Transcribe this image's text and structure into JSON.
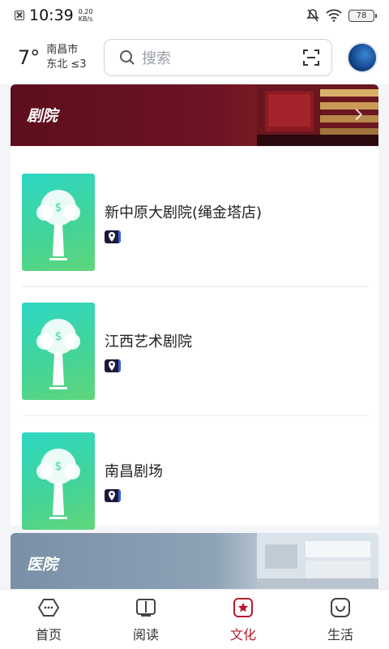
{
  "status_bar": {
    "time": "10:39",
    "speed_value": "0.20",
    "speed_unit": "KB/s",
    "battery": "78"
  },
  "header": {
    "temperature": "7°",
    "city": "南昌市",
    "wind": "东北  ≤3",
    "search_placeholder": "搜索"
  },
  "sections": [
    {
      "title": "剧院",
      "items": [
        {
          "name": "新中原大剧院(绳金塔店)"
        },
        {
          "name": "江西艺术剧院"
        },
        {
          "name": "南昌剧场"
        }
      ]
    },
    {
      "title": "医院"
    }
  ],
  "bottom_nav": [
    {
      "label": "首页",
      "icon": "home-icon"
    },
    {
      "label": "阅读",
      "icon": "book-icon"
    },
    {
      "label": "文化",
      "icon": "star-icon",
      "active": true
    },
    {
      "label": "生活",
      "icon": "life-icon"
    }
  ],
  "colors": {
    "accent": "#b71c2c",
    "theater_banner": "#5e0e1e",
    "thumb_green": "#43d49a"
  }
}
